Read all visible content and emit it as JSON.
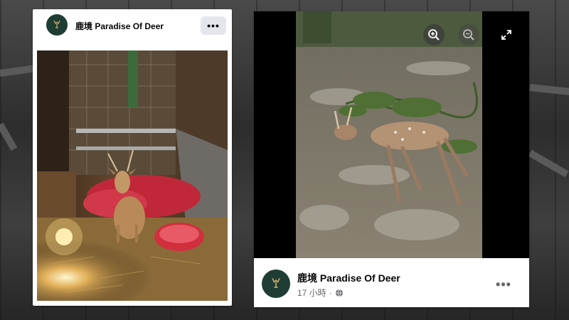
{
  "left_post": {
    "page_name": "鹿境 Paradise Of Deer",
    "more_label": "•••",
    "avatar_icon": "deer-logo-icon",
    "photo_description_icon": "deer-in-barn-photo"
  },
  "right_post": {
    "page_name": "鹿境 Paradise Of Deer",
    "time_label": "17 小時",
    "separator": "·",
    "audience_icon": "globe-icon",
    "more_label": "•••",
    "avatar_icon": "deer-logo-icon",
    "controls": {
      "zoom_in_icon": "zoom-in-icon",
      "zoom_out_icon": "zoom-out-icon",
      "fullscreen_icon": "fullscreen-icon"
    },
    "photo_description_icon": "deer-on-muddy-ground-photo"
  },
  "colors": {
    "avatar_bg": "#1f3d34",
    "logo_gold": "#c8a96a",
    "text_primary": "#050505",
    "text_secondary": "#65676b",
    "button_bg": "#e4e6eb"
  }
}
